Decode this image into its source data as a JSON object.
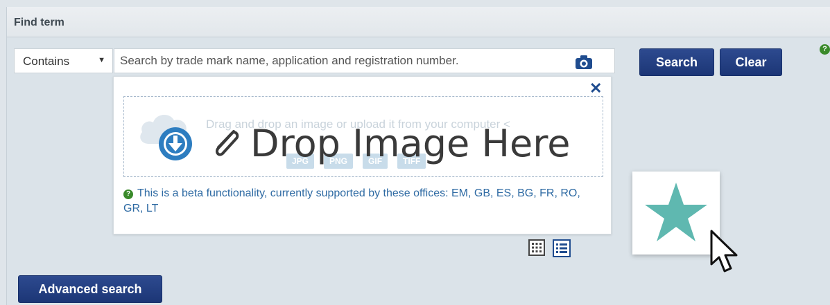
{
  "panel": {
    "title": "Find term"
  },
  "search": {
    "mode": "Contains",
    "placeholder": "Search by trade mark name, application and registration number.",
    "search_label": "Search",
    "clear_label": "Clear"
  },
  "image_dropzone": {
    "hint": "Drag and drop an image or upload it from your computer <",
    "overlay_text": "Drop Image Here",
    "formats": [
      "JPG",
      "PNG",
      "GIF",
      "TIFF"
    ],
    "beta_text": "This is a beta functionality, currently supported by these offices: EM, GB, ES, BG, FR, RO, GR, LT"
  },
  "footer": {
    "advanced_label": "Advanced search"
  },
  "colors": {
    "primary": "#1f3a7d",
    "help_green": "#3a8a2a",
    "star": "#5fb8b0",
    "download_blue": "#2d7dc0"
  },
  "icons": [
    "camera-icon",
    "close-icon",
    "cloud-upload-icon",
    "download-icon",
    "paperclip-icon",
    "help-icon",
    "grid-view-icon",
    "list-view-icon",
    "star-icon",
    "cursor-icon"
  ]
}
